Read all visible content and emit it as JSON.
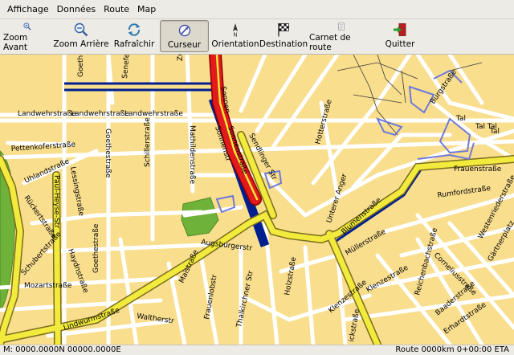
{
  "menu": [
    "Affichage",
    "Données",
    "Route",
    "Map"
  ],
  "toolbar": {
    "zoom_in": "Zoom Avant",
    "zoom_out": "Zoom Arrière",
    "refresh": "Rafraîchir",
    "cursor": "Curseur",
    "orientation": "Orientation",
    "destination": "Destination",
    "roadbook": "Carnet de route",
    "quit": "Quitter"
  },
  "streets": {
    "goethe1": "Goethe",
    "senefelder1": "Senefeld",
    "zwe": "Zwe",
    "sonnen1": "Sonnen",
    "sonnen2": "Sonnenstraße",
    "sonnen3": "Sonnenstr",
    "sendlinger": "Sendlinger Str",
    "landwehr1": "Landwehrstraße",
    "landwehr2": "Landwehrstraße",
    "landwehr3": "Landwehrstraße",
    "pettenkofer": "Pettenkoferstraße",
    "goethe2": "Goethestraße",
    "schiller": "Schillerstraße",
    "mathilden": "Mathildenstraße",
    "uhland": "Uhlandstraße",
    "lessing": "Lessingstraße",
    "paul_heyse": "Paul-Heyse-Str",
    "ruckert": "Rückertstraße",
    "schubert": "Schubertstraße",
    "haydn": "Haydnstraße",
    "goethe3": "Goethestraße",
    "mozart": "Mozartstraße",
    "lindwurm": "Lindwurmstraße",
    "walther": "Waltherstr",
    "augsburger": "Augsburgerstr",
    "maistr": "Maistraße",
    "frauenlob": "Frauenlobstr",
    "thalkirchner": "Thalkirchner Str",
    "hotter": "Hotterstraße",
    "unterer_anger": "Unterer Anger",
    "blumen": "Blumenstraße",
    "muller": "Müllerstraße",
    "holz": "Holzstraße",
    "klenze1": "Klenzestraße",
    "klenze2": "Klenzestraße",
    "reichenbach": "Reichenbachstraße",
    "corneliusstr": "Corneliusstraße",
    "baader": "Baaderstraße",
    "rumford": "Rumfordstraße",
    "frauen": "Frauenstraße",
    "burg": "Burgstraße",
    "tal1": "Tal",
    "tal2": "Tal",
    "tal3": "Tal Tal",
    "westenrieder": "Westenriederstraße",
    "erhardt": "Erhardtstraße",
    "gartner": "Gärtnerplatz",
    "ick": "ickstraße"
  },
  "status": {
    "position": "M: 0000.0000N 00000.0000E",
    "route": "Route 0000km  0+00:00 ETA"
  },
  "colors": {
    "map_bg": "#f9de8e",
    "route_red": "#e31a1c",
    "major_road": "#f2ea3c",
    "route_blue": "#001f8f",
    "park": "#6fb23a",
    "poi_outline": "#6f79d9"
  }
}
